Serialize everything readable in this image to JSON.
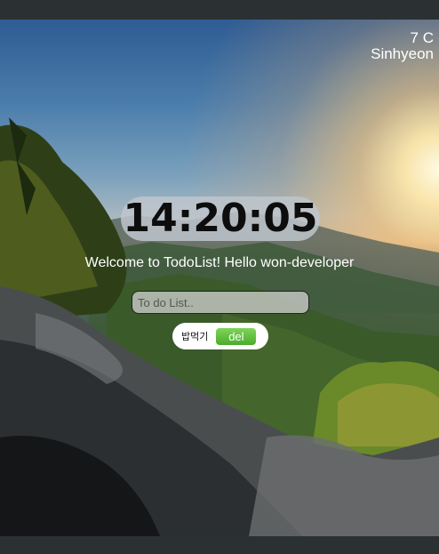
{
  "weather": {
    "temp": "7 C",
    "city": "Sinhyeon"
  },
  "clock": {
    "time": "14:20:05"
  },
  "greeting": {
    "text": "Welcome to TodoList! Hello won-developer"
  },
  "todo": {
    "placeholder": "To do List..",
    "items": [
      {
        "text": "밥먹기",
        "delete_label": "del"
      }
    ]
  },
  "colors": {
    "delete_button": "#5cbf3a",
    "clock_pill": "#bec6cd",
    "frame": "#2b3133"
  }
}
